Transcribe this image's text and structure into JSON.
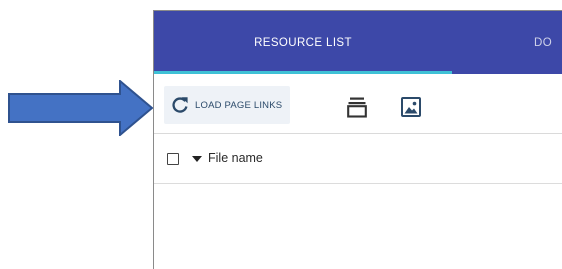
{
  "tabs": {
    "resource_list": "RESOURCE LIST",
    "second_partial": "DO"
  },
  "toolbar": {
    "load_page_links": "LOAD PAGE LINKS",
    "icons": [
      "refresh-icon",
      "stack-icon",
      "image-icon"
    ]
  },
  "table": {
    "column_file_name": "File name"
  },
  "colors": {
    "tabbar": "#3d48a8",
    "tab_indicator": "#3fc1d6",
    "callout_arrow_fill": "#4472c4",
    "callout_arrow_stroke": "#2f528f"
  }
}
